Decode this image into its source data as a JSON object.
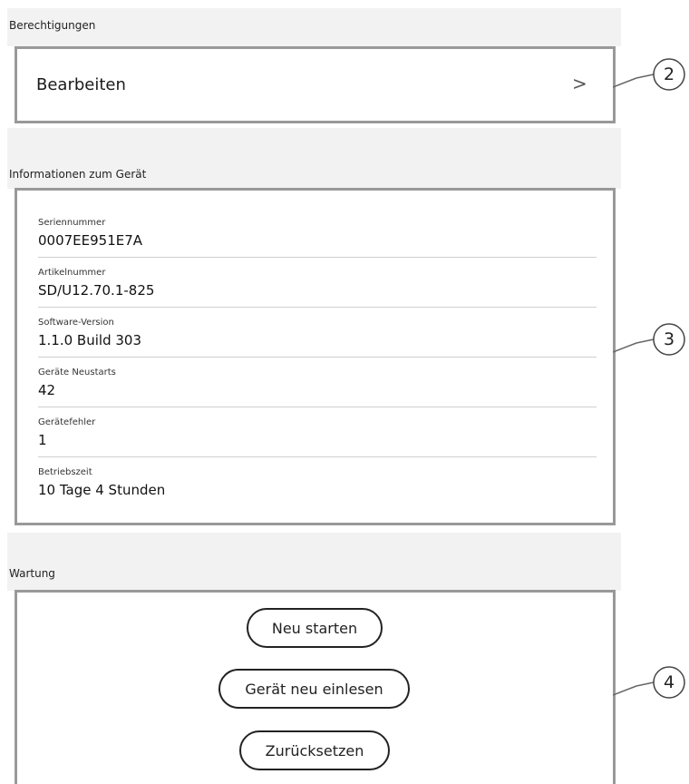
{
  "permissions": {
    "section_label": "Berechtigungen",
    "edit_label": "Bearbeiten",
    "chevron": ">"
  },
  "device_info": {
    "section_label": "Informationen zum Gerät",
    "items": [
      {
        "label": "Seriennummer",
        "value": "0007EE951E7A"
      },
      {
        "label": "Artikelnummer",
        "value": "SD/U12.70.1-825"
      },
      {
        "label": "Software-Version",
        "value": "1.1.0 Build 303"
      },
      {
        "label": "Geräte Neustarts",
        "value": "42"
      },
      {
        "label": "Gerätefehler",
        "value": "1"
      },
      {
        "label": "Betriebszeit",
        "value": "10 Tage 4 Stunden"
      }
    ]
  },
  "maintenance": {
    "section_label": "Wartung",
    "buttons": {
      "restart": "Neu starten",
      "reload": "Gerät neu einlesen",
      "reset": "Zurücksetzen"
    }
  },
  "callouts": {
    "permissions": "2",
    "device_info": "3",
    "maintenance": "4"
  }
}
